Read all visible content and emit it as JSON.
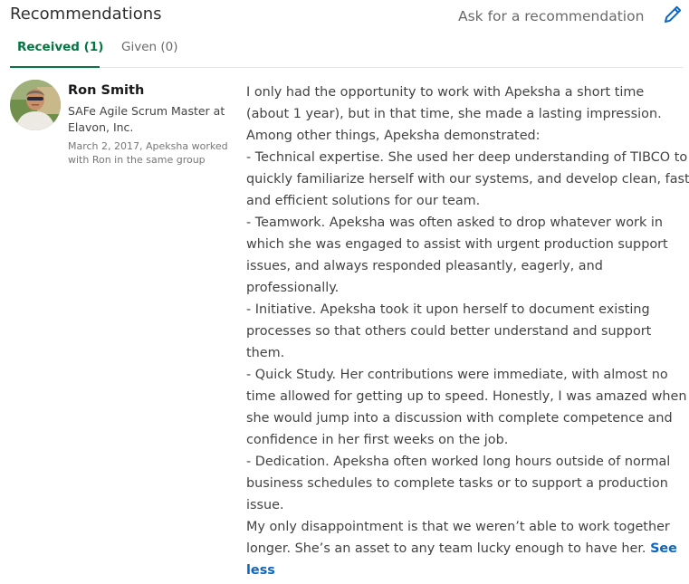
{
  "section": {
    "title": "Recommendations",
    "ask_label": "Ask for a recommendation",
    "edit_icon": "pencil-icon",
    "accent_color": "#057642",
    "link_color": "#0a66c2"
  },
  "tabs": [
    {
      "label": "Received (1)",
      "active": true
    },
    {
      "label": "Given (0)",
      "active": false
    }
  ],
  "recommendation": {
    "name": "Ron Smith",
    "headline_lines": [
      "SAFe Agile Scrum Master at",
      "Elavon, Inc."
    ],
    "meta_lines": [
      "March 2, 2017, Apeksha worked",
      "with Ron in the same group"
    ],
    "body_lines": [
      "I only had the opportunity to work with Apeksha a short time",
      "(about 1 year), but in that time, she made a lasting impression.",
      "Among other things, Apeksha demonstrated:",
      "- Technical expertise. She used her deep understanding of TIBCO to",
      "quickly familiarize herself with our systems, and develop clean, fast,",
      "and efficient solutions for our team.",
      "- Teamwork. Apeksha was often asked to drop whatever work in",
      "which she was engaged to assist with urgent production support",
      "issues, and always responded pleasantly, eagerly, and",
      "professionally.",
      "- Initiative. Apeksha took it upon herself to document existing",
      "processes so that others could better understand and support",
      "them.",
      "- Quick Study. Her contributions were immediate, with almost no",
      "time allowed for getting up to speed. Honestly, I was amazed when",
      "she would jump into a discussion with complete competence and",
      "confidence in her first weeks on the job.",
      "- Dedication. Apeksha often worked long hours outside of normal",
      "business schedules to complete tasks or to support a production",
      "issue.",
      "My only disappointment is that we weren’t able to work together",
      "longer. She’s an asset to any team lucky enough to have her."
    ],
    "see_less_part1": "See",
    "see_less_part2": "less"
  }
}
